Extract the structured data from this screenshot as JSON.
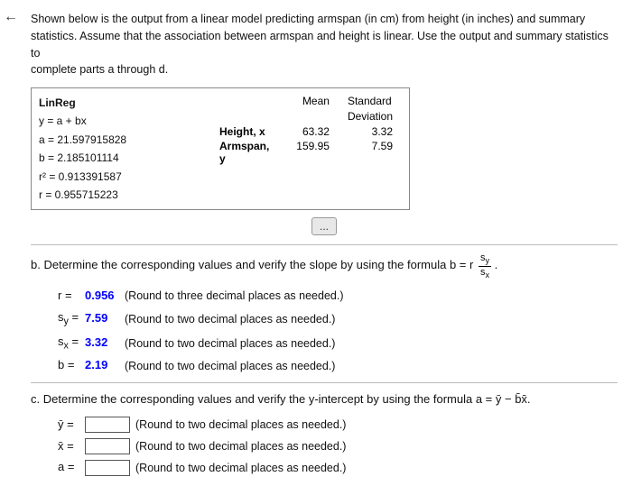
{
  "back_arrow": "←",
  "intro": {
    "line1": "Shown below is the output from a linear model predicting armspan (in cm) from height (in inches) and summary",
    "line2": "statistics. Assume that the association between armspan and height is linear. Use the output and summary statistics to",
    "line3": "complete parts a through d."
  },
  "linreg": {
    "title": "LinReg",
    "equations": [
      "y = a + bx",
      "a = 21.597915828",
      "b = 2.185101114",
      "r² = 0.913391587",
      "r = 0.955715223"
    ]
  },
  "stats": {
    "mean_label": "Mean",
    "std_label": "Standard",
    "dev_label": "Deviation",
    "rows": [
      {
        "label": "Height, x",
        "mean": "63.32",
        "std": "3.32"
      },
      {
        "label": "Armspan, y",
        "mean": "159.95",
        "std": "7.59"
      }
    ]
  },
  "expand_btn": "...",
  "part_b": {
    "label": "b.",
    "text": "Determine the corresponding values and verify the slope by using the formula b = r",
    "formula_num": "s",
    "formula_num_sub": "y",
    "formula_den": "s",
    "formula_den_sub": "x",
    "period": ".",
    "answers": [
      {
        "var": "r =",
        "val": "0.956",
        "note": "(Round to three decimal places as needed.)"
      },
      {
        "var": "s_y =",
        "val": "7.59",
        "note": "(Round to two decimal places as needed.)"
      },
      {
        "var": "s_x =",
        "val": "3.32",
        "note": "(Round to two decimal places as needed.)"
      },
      {
        "var": "b =",
        "val": "2.19",
        "note": "(Round to two decimal places as needed.)"
      }
    ]
  },
  "part_c": {
    "label": "c.",
    "text": "Determine the corresponding values and verify the y-intercept by using the formula a = ȳ − b̄x̄.",
    "answers": [
      {
        "var": "ȳ =",
        "placeholder": "",
        "note": "(Round to two decimal places as needed.)"
      },
      {
        "var": "x̄ =",
        "placeholder": "",
        "note": "(Round to two decimal places as needed.)"
      },
      {
        "var": "a =",
        "placeholder": "",
        "note": "(Round to two decimal places as needed.)"
      }
    ]
  }
}
